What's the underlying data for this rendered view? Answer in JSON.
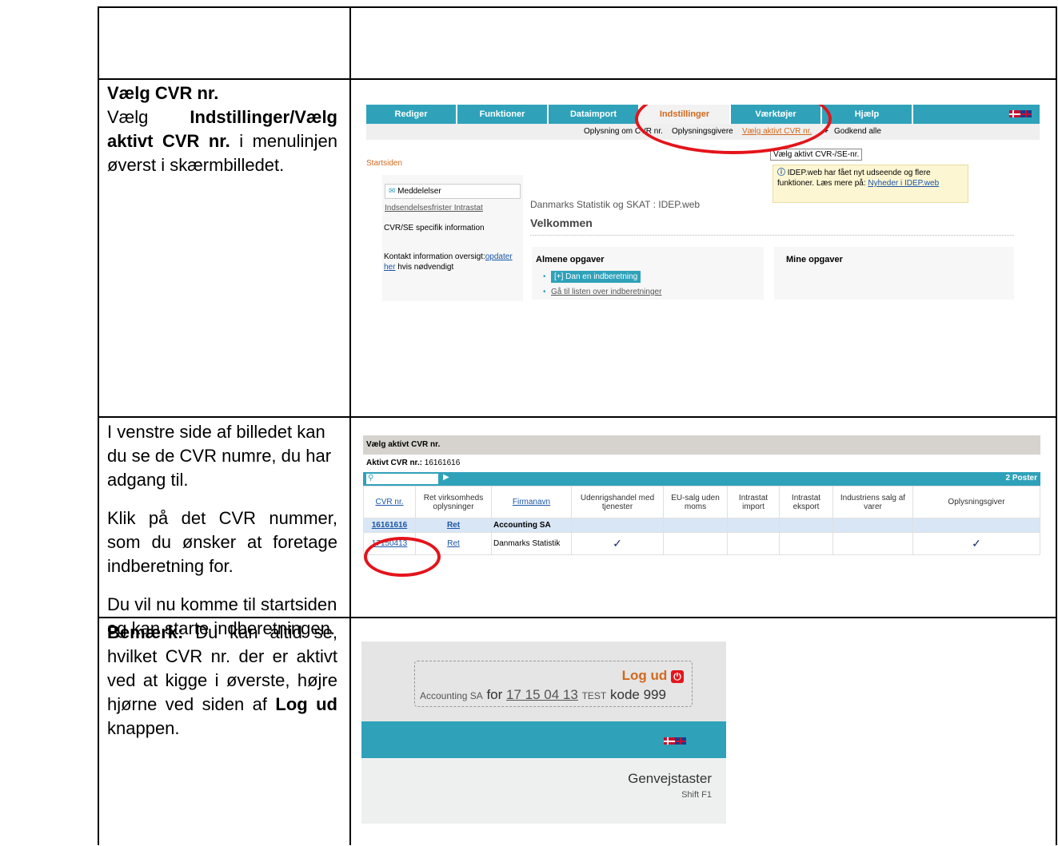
{
  "left": {
    "section1": {
      "heading": "Vælg CVR nr.",
      "line_pre": "Vælg",
      "menu_path_1": "Indstillinger",
      "slash": "/",
      "menu_path_2": "Vælg aktivt CVR nr.",
      "line_post": "i menulinjen øverst i skærmbilledet."
    },
    "section2": {
      "p1": "I venstre side af billedet kan du se de CVR numre, du har adgang til.",
      "p2": "Klik på det CVR nummer, som du ønsker at foretage indberetning for.",
      "p3": "Du vil nu komme til startsiden og kan starte indberetningen."
    },
    "section3": {
      "bold": "Bemærk:",
      "text": "Du kan altid se, hvilket CVR nr. der er aktivt ved at kigge i øverste, højre hjørne ved siden af",
      "bold2": "Log ud",
      "text2": "knappen."
    }
  },
  "shot1": {
    "tabs": [
      "Rediger",
      "Funktioner",
      "Dataimport",
      "Indstillinger",
      "Værktøjer",
      "Hjælp"
    ],
    "submenu": {
      "item1": "Oplysning om CVR nr.",
      "item2": "Oplysningsgivere",
      "item3": "Vælg aktivt CVR nr.",
      "item4": "Godkend alle"
    },
    "tooltip": "Vælg aktivt CVR-/SE-nr.",
    "notice": "IDEP.web har fået nyt udseende og flere funktioner. Læs mere på:",
    "notice_link": "Nyheder i IDEP.web",
    "startsiden": "Startsiden",
    "messages": "Meddelelser",
    "deadlines_link": "Indsendelsesfrister Intrastat",
    "cvr_info": "CVR/SE specifik information",
    "contact_pre": "Kontakt information oversigt:",
    "contact_link": "opdater her",
    "contact_post": "hvis nødvendigt",
    "site_title": "Danmarks Statistik og SKAT : IDEP.web",
    "welcome": "Velkommen",
    "general_tasks": "Almene opgaver",
    "new_report": "[+] Dan en indberetning",
    "list_link": "Gå til listen over indberetninger",
    "my_tasks": "Mine opgaver"
  },
  "shot2": {
    "title": "Vælg aktivt CVR nr.",
    "active_label": "Aktivt CVR nr.:",
    "active_value": "16161616",
    "post_count": "2 Poster",
    "columns": [
      "CVR nr.",
      "Ret virksomheds oplysninger",
      "Firmanavn",
      "Udenrigshandel med tjenester",
      "EU-salg uden moms",
      "Intrastat import",
      "Intrastat eksport",
      "Industriens salg af varer",
      "Oplysningsgiver"
    ],
    "rows": [
      {
        "cvr": "16161616",
        "edit": "Ret",
        "name": "Accounting SA",
        "check_services": "",
        "check_giver": ""
      },
      {
        "cvr": "17150413",
        "edit": "Ret",
        "name": "Danmarks Statistik",
        "check_services": "✓",
        "check_giver": "✓"
      }
    ]
  },
  "shot3": {
    "logout": "Log ud",
    "company": "Accounting SA",
    "for": "for",
    "cvr": "17 15 04 13",
    "test": "TEST",
    "kode": "kode 999",
    "shortcuts": "Genvejstaster",
    "shift": "Shift F1"
  },
  "colors": {
    "accent": "#2fa2ba",
    "tab_active_text": "#d2691e",
    "highlight_circle": "#e4141b",
    "link": "#1a56a8"
  }
}
